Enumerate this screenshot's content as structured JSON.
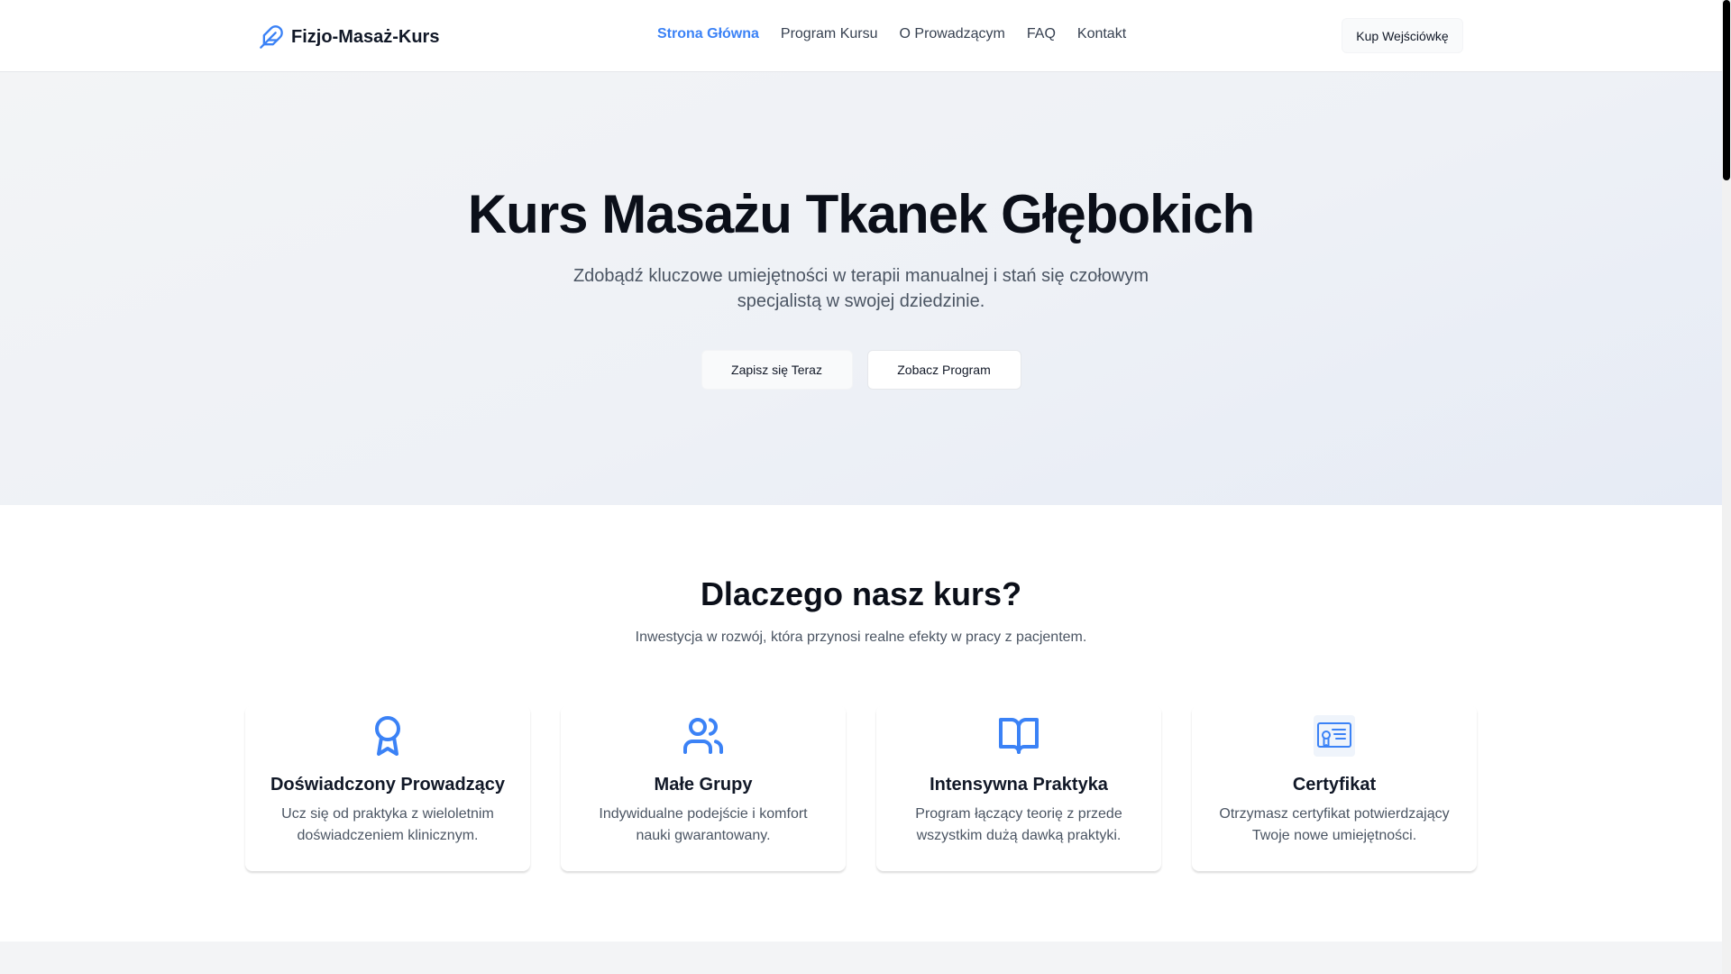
{
  "header": {
    "brand": "Fizjo-Masaż-Kurs",
    "brand_icon": "feather-icon",
    "nav": [
      {
        "label": "Strona Główna",
        "active": true
      },
      {
        "label": "Program Kursu",
        "active": false
      },
      {
        "label": "O Prowadzącym",
        "active": false
      },
      {
        "label": "FAQ",
        "active": false
      },
      {
        "label": "Kontakt",
        "active": false
      }
    ],
    "cta": "Kup Wejściówkę"
  },
  "hero": {
    "title": "Kurs Masażu Tkanek Głębokich",
    "subtitle": "Zdobądź kluczowe umiejętności w terapii manualnej i stań się czołowym specjalistą w swojej dziedzinie.",
    "primary_button": "Zapisz się Teraz",
    "secondary_button": "Zobacz Program"
  },
  "features": {
    "title": "Dlaczego nasz kurs?",
    "subtitle": "Inwestycja w rozwój, która przynosi realne efekty w pracy z pacjentem.",
    "items": [
      {
        "icon": "award-icon",
        "title": "Doświadczony Prowadzący",
        "description": "Ucz się od praktyka z wieloletnim doświadczeniem klinicznym."
      },
      {
        "icon": "users-icon",
        "title": "Małe Grupy",
        "description": "Indywidualne podejście i komfort nauki gwarantowany."
      },
      {
        "icon": "book-open-icon",
        "title": "Intensywna Praktyka",
        "description": "Program łączący teorię z przede wszystkim dużą dawką praktyki."
      },
      {
        "icon": "certificate-icon",
        "title": "Certyfikat",
        "description": "Otrzymasz certyfikat potwierdzający Twoje nowe umiejętności."
      }
    ]
  },
  "colors": {
    "accent": "#3b82f6",
    "text": "#111827",
    "muted": "#4b5563"
  }
}
